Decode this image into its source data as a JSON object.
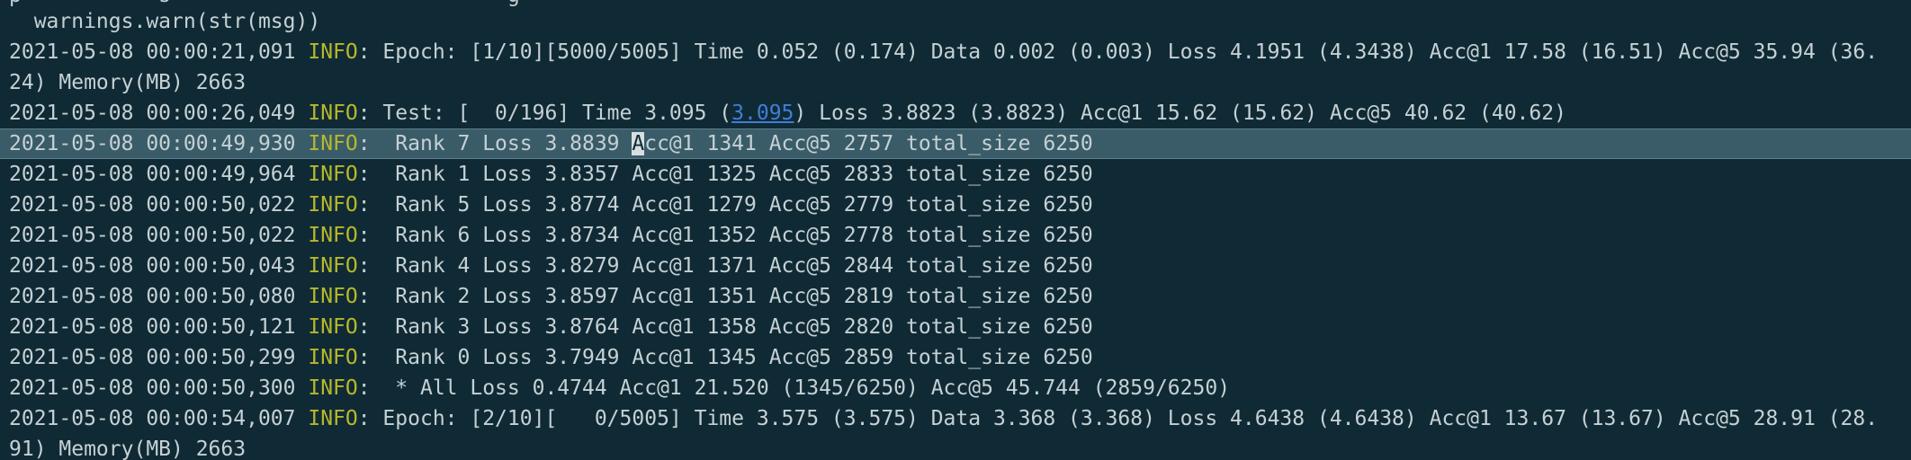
{
  "terminal": {
    "cut_top_text": "p           s                           g",
    "warn_line": "  warnings.warn(str(msg))",
    "lines": [
      {
        "ts": "2021-05-08 00:00:21,091 ",
        "lvl": "INFO",
        "msg": ": Epoch: [1/10][5000/5005] Time 0.052 (0.174) Data 0.002 (0.003) Loss 4.1951 (4.3438) Acc@1 17.58 (16.51) Acc@5 35.94 (36."
      },
      {
        "wrap": "24) Memory(MB) 2663"
      },
      {
        "ts": "2021-05-08 00:00:26,049 ",
        "lvl": "INFO",
        "msg_pre": ": Test: [  0/196] Time 3.095 (",
        "link": "3.095",
        "msg_post": ") Loss 3.8823 (3.8823) Acc@1 15.62 (15.62) Acc@5 40.62 (40.62)"
      },
      {
        "ts": "2021-05-08 00:00:49,930 ",
        "lvl": "INFO",
        "msg_pre": ":  Rank 7 Loss 3.8839 ",
        "cursor": "A",
        "msg_post": "cc@1 1341 Acc@5 2757 total_size 6250"
      },
      {
        "ts": "2021-05-08 00:00:49,964 ",
        "lvl": "INFO",
        "msg": ":  Rank 1 Loss 3.8357 Acc@1 1325 Acc@5 2833 total_size 6250"
      },
      {
        "ts": "2021-05-08 00:00:50,022 ",
        "lvl": "INFO",
        "msg": ":  Rank 5 Loss 3.8774 Acc@1 1279 Acc@5 2779 total_size 6250"
      },
      {
        "ts": "2021-05-08 00:00:50,022 ",
        "lvl": "INFO",
        "msg": ":  Rank 6 Loss 3.8734 Acc@1 1352 Acc@5 2778 total_size 6250"
      },
      {
        "ts": "2021-05-08 00:00:50,043 ",
        "lvl": "INFO",
        "msg": ":  Rank 4 Loss 3.8279 Acc@1 1371 Acc@5 2844 total_size 6250"
      },
      {
        "ts": "2021-05-08 00:00:50,080 ",
        "lvl": "INFO",
        "msg": ":  Rank 2 Loss 3.8597 Acc@1 1351 Acc@5 2819 total_size 6250"
      },
      {
        "ts": "2021-05-08 00:00:50,121 ",
        "lvl": "INFO",
        "msg": ":  Rank 3 Loss 3.8764 Acc@1 1358 Acc@5 2820 total_size 6250"
      },
      {
        "ts": "2021-05-08 00:00:50,299 ",
        "lvl": "INFO",
        "msg": ":  Rank 0 Loss 3.7949 Acc@1 1345 Acc@5 2859 total_size 6250"
      },
      {
        "ts": "2021-05-08 00:00:50,300 ",
        "lvl": "INFO",
        "msg": ":  * All Loss 0.4744 Acc@1 21.520 (1345/6250) Acc@5 45.744 (2859/6250)"
      },
      {
        "ts": "2021-05-08 00:00:54,007 ",
        "lvl": "INFO",
        "msg": ": Epoch: [2/10][   0/5005] Time 3.575 (3.575) Data 3.368 (3.368) Loss 4.6438 (4.6438) Acc@1 13.67 (13.67) Acc@5 28.91 (28."
      },
      {
        "wrap": "91) Memory(MB) 2663"
      }
    ]
  },
  "colors": {
    "background": "#102a35",
    "text": "#c5d1d4",
    "info_level": "#b6b92b",
    "link": "#3f7ed8",
    "selection": "#3a5c68"
  }
}
